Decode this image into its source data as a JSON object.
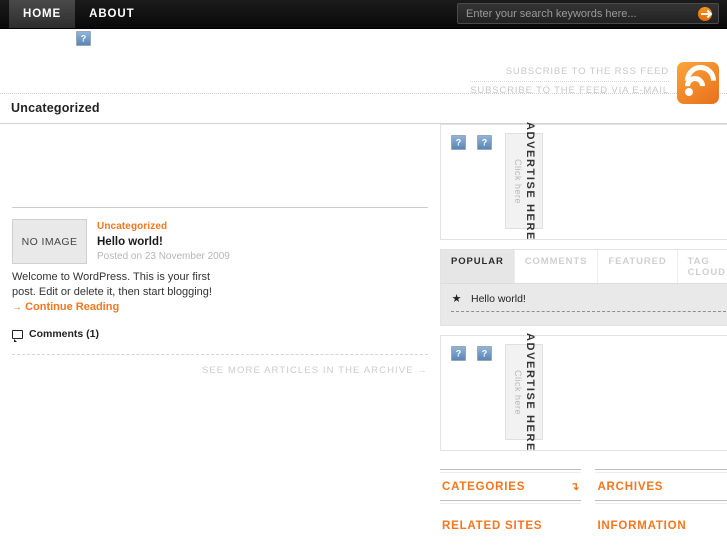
{
  "topbar": {
    "nav": [
      {
        "label": "HOME",
        "active": true
      },
      {
        "label": "ABOUT",
        "active": false
      }
    ],
    "search": {
      "placeholder": "Enter your search keywords here...",
      "value": "",
      "button_icon": "arrow-right-icon"
    }
  },
  "header": {
    "logo_icon": "broken-image-icon",
    "rss": {
      "feed_label": "SUBSCRIBE TO THE RSS FEED",
      "email_label": "SUBSCRIBE TO THE FEED VIA E-MAIL",
      "icon": "rss-icon"
    }
  },
  "page": {
    "title": "Uncategorized"
  },
  "post": {
    "thumb_text": "NO IMAGE",
    "category": "Uncategorized",
    "title": "Hello world!",
    "date": "Posted on 23 November 2009",
    "excerpt": "Welcome to WordPress. This is your first post. Edit or delete it, then start blogging!",
    "more_label": "Continue Reading",
    "more_arrow": "→",
    "comments_label": "Comments (1)",
    "comments_icon": "speech-bubble-icon"
  },
  "archive": {
    "label": "SEE MORE ARTICLES IN THE ARCHIVE",
    "arrow": "→"
  },
  "sidebar": {
    "ads": [
      {
        "icon_a": "broken-image-icon",
        "icon_b": "broken-image-icon",
        "banner_title": "ADVERTISE HERE",
        "banner_sub": "Click here"
      },
      {
        "icon_a": "broken-image-icon",
        "icon_b": "broken-image-icon",
        "banner_title": "ADVERTISE HERE",
        "banner_sub": "Click here"
      }
    ],
    "tabs": [
      {
        "label": "POPULAR",
        "active": true
      },
      {
        "label": "COMMENTS",
        "active": false
      },
      {
        "label": "FEATURED",
        "active": false
      },
      {
        "label": "TAG CLOUD",
        "active": false
      }
    ],
    "tab_items": [
      {
        "icon": "star-icon",
        "label": "Hello world!"
      }
    ],
    "link_sections": [
      {
        "title": "CATEGORIES",
        "arrow": "↴"
      },
      {
        "title": "ARCHIVES",
        "arrow": "↴"
      },
      {
        "title": "RELATED SITES",
        "arrow": ""
      },
      {
        "title": "INFORMATION",
        "arrow": ""
      }
    ]
  },
  "colors": {
    "accent_orange": "#f4761f",
    "nav_black": "#111111",
    "muted_gray": "#c9c9c9"
  }
}
